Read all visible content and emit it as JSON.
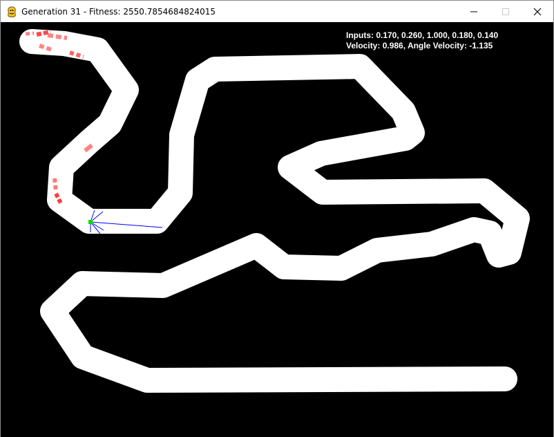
{
  "window": {
    "title": "Generation 31 - Fitness: 2550.7854684824015",
    "app_icon": "pygame-snake-icon",
    "controls": [
      "minimize-icon",
      "maximize-icon",
      "close-icon"
    ]
  },
  "hud": {
    "inputs_text": "Inputs: 0.170, 0.260, 1.000, 0.180, 0.140",
    "velocity_text": "Velocity: 0.986, Angle Velocity: -1.135"
  },
  "colors": {
    "background": "#000000",
    "track": "#ffffff",
    "car": "#00e000",
    "sensor": "#0000ff",
    "trail": "#ff2020"
  }
}
